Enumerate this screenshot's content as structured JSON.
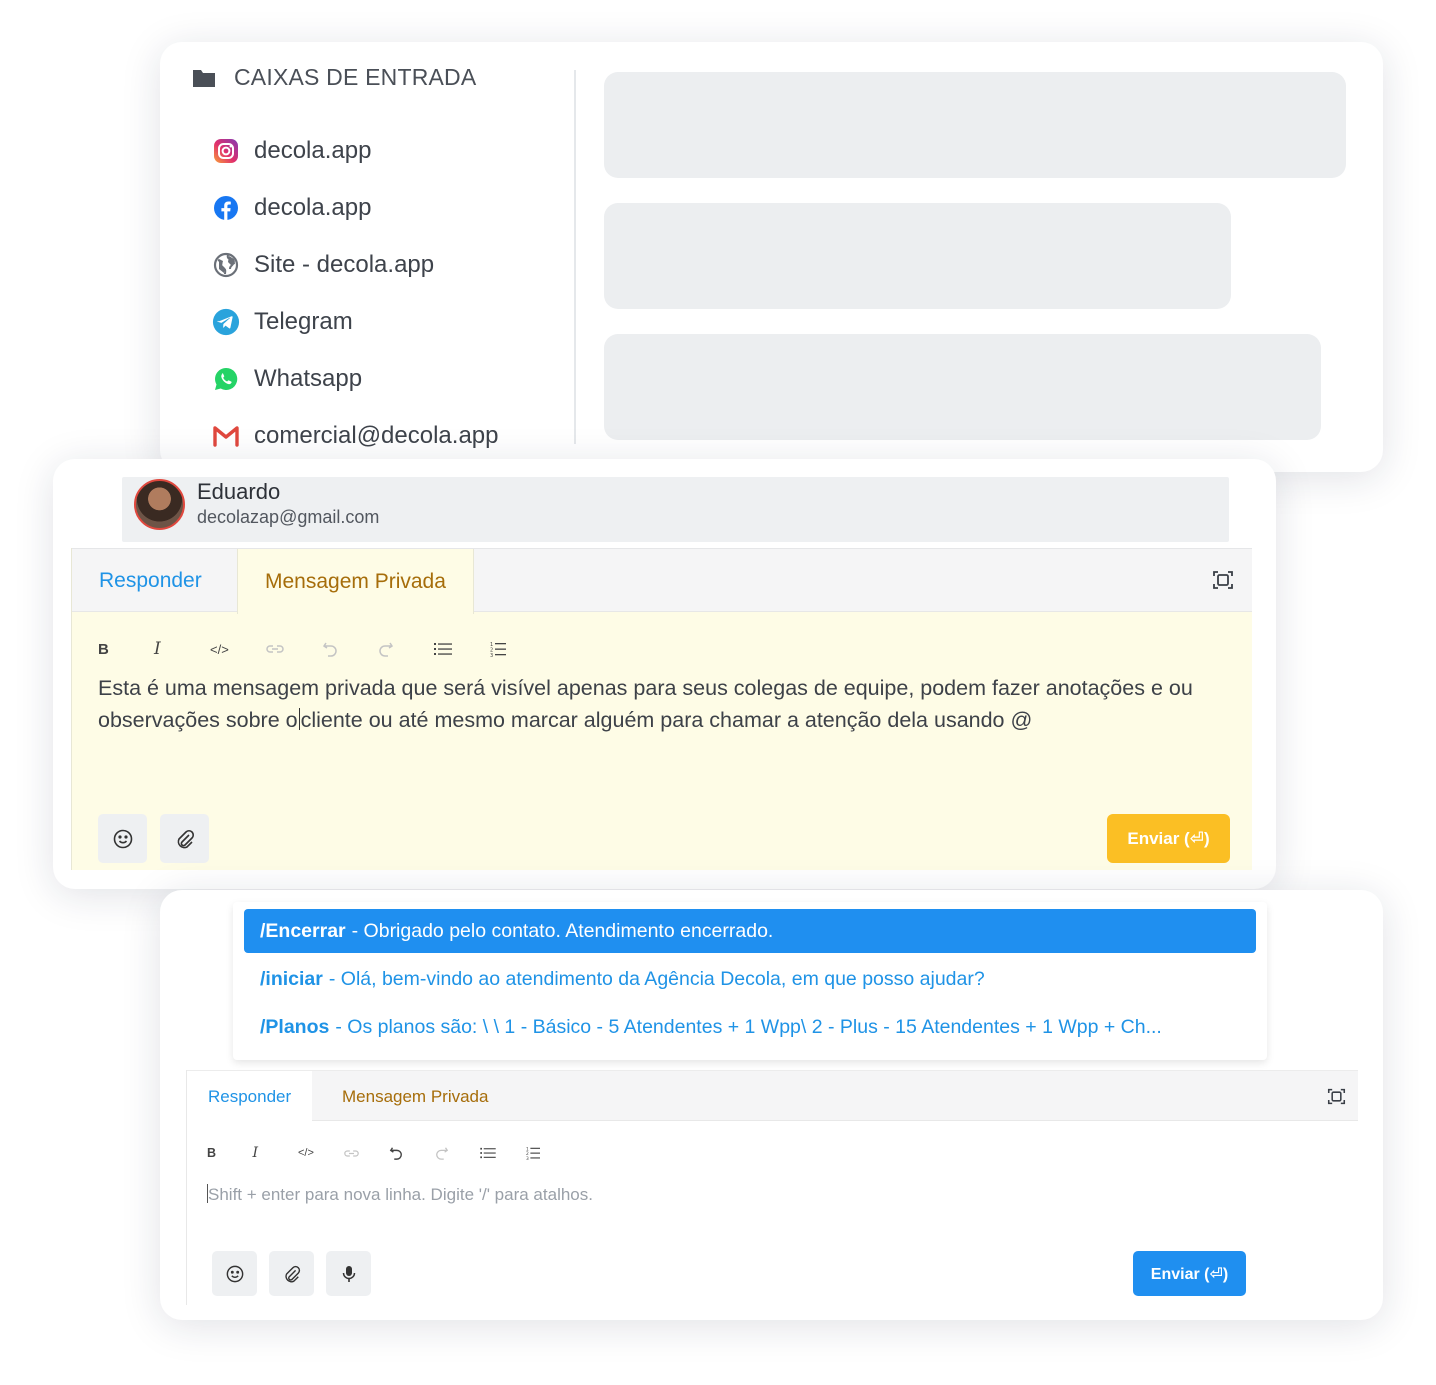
{
  "inboxes": {
    "title": "CAIXAS DE ENTRADA",
    "items": [
      {
        "label": "decola.app",
        "icon": "instagram-icon"
      },
      {
        "label": "decola.app",
        "icon": "facebook-icon"
      },
      {
        "label": "Site - decola.app",
        "icon": "globe-icon"
      },
      {
        "label": "Telegram",
        "icon": "telegram-icon"
      },
      {
        "label": "Whatsapp",
        "icon": "whatsapp-icon"
      },
      {
        "label": "comercial@decola.app",
        "icon": "gmail-icon"
      }
    ]
  },
  "contact": {
    "name": "Eduardo",
    "email": "decolazap@gmail.com"
  },
  "private_editor": {
    "tabs": [
      "Responder",
      "Mensagem Privada"
    ],
    "active_tab": "Mensagem Privada",
    "toolbar": [
      "B",
      "I",
      "</>"
    ],
    "text_before_caret": "Esta é uma mensagem privada que será visível apenas para seus colegas de equipe, podem fazer anotações e ou observações sobre o",
    "text_after_caret": "cliente ou até mesmo marcar alguém para chamar a atenção dela usando @",
    "send_label": "Enviar (⏎)",
    "send_color": "#fbbf24"
  },
  "canned_responses": [
    {
      "shortcut": "/Encerrar",
      "text": "- Obrigado pelo contato. Atendimento encerrado.",
      "active": true
    },
    {
      "shortcut": "/iniciar",
      "text": "- Olá, bem-vindo ao atendimento da Agência Decola, em que posso ajudar?",
      "active": false
    },
    {
      "shortcut": "/Planos",
      "text": "- Os planos são: \\ \\ 1 - Básico - 5 Atendentes + 1 Wpp\\ 2 - Plus - 15 Atendentes + 1 Wpp + Ch...",
      "active": false
    }
  ],
  "reply_editor": {
    "tabs": [
      "Responder",
      "Mensagem Privada"
    ],
    "active_tab": "Responder",
    "toolbar": [
      "B",
      "I",
      "</>"
    ],
    "placeholder": "Shift + enter para nova linha. Digite '/' para atalhos.",
    "send_label": "Enviar (⏎)",
    "send_color": "#1f8ff0"
  },
  "colors": {
    "accent_blue": "#1f93e6",
    "private_tab": "#a66d0a",
    "private_background": "#fefce6"
  }
}
